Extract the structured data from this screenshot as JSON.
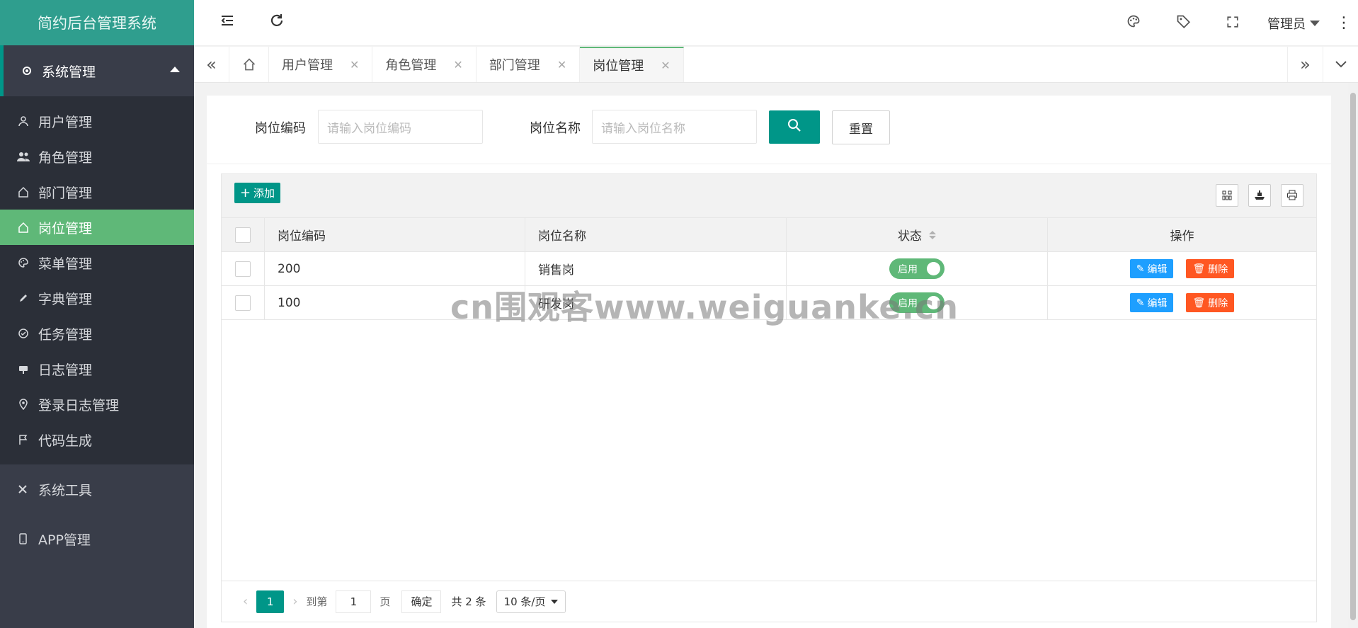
{
  "app": {
    "title": "简约后台管理系统"
  },
  "sidebar": {
    "group_system": "系统管理",
    "items": [
      {
        "label": "用户管理",
        "icon": "user-icon"
      },
      {
        "label": "角色管理",
        "icon": "users-icon"
      },
      {
        "label": "部门管理",
        "icon": "home-icon"
      },
      {
        "label": "岗位管理",
        "icon": "home-icon",
        "active": true
      },
      {
        "label": "菜单管理",
        "icon": "palette-icon"
      },
      {
        "label": "字典管理",
        "icon": "pen-icon"
      },
      {
        "label": "任务管理",
        "icon": "check-circle-icon"
      },
      {
        "label": "日志管理",
        "icon": "log-icon"
      },
      {
        "label": "登录日志管理",
        "icon": "location-icon"
      },
      {
        "label": "代码生成",
        "icon": "flag-icon"
      }
    ],
    "group_tools": "系统工具",
    "group_app": "APP管理"
  },
  "header": {
    "user_name": "管理员"
  },
  "tabs": [
    {
      "label": "用户管理"
    },
    {
      "label": "角色管理"
    },
    {
      "label": "部门管理"
    },
    {
      "label": "岗位管理",
      "active": true
    }
  ],
  "search": {
    "code_label": "岗位编码",
    "code_placeholder": "请输入岗位编码",
    "name_label": "岗位名称",
    "name_placeholder": "请输入岗位名称",
    "reset_label": "重置"
  },
  "toolbar": {
    "add_label": "添加"
  },
  "table": {
    "headers": {
      "code": "岗位编码",
      "name": "岗位名称",
      "status": "状态",
      "ops": "操作"
    },
    "rows": [
      {
        "code": "200",
        "name": "销售岗",
        "status": "启用",
        "edit": "编辑",
        "delete": "删除"
      },
      {
        "code": "100",
        "name": "研发岗",
        "status": "启用",
        "edit": "编辑",
        "delete": "删除"
      }
    ]
  },
  "pager": {
    "current": "1",
    "goto_label": "到第",
    "goto_value": "1",
    "page_label": "页",
    "confirm_label": "确定",
    "total": "共 2 条",
    "page_size": "10 条/页"
  },
  "watermark": "cn围观客www.weiguanke.cn",
  "colors": {
    "primary": "#009688",
    "active_menu": "#5fb878",
    "edit": "#1e9fff",
    "delete": "#ff5722",
    "sidebar": "#393d49"
  }
}
